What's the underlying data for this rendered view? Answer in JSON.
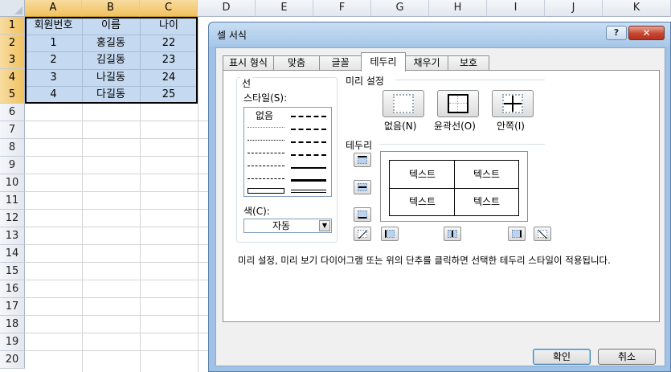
{
  "sheet": {
    "columns": [
      "A",
      "B",
      "C",
      "D",
      "E",
      "F",
      "G",
      "H",
      "I",
      "J",
      "K"
    ],
    "rows": [
      "1",
      "2",
      "3",
      "4",
      "5",
      "6",
      "7",
      "8",
      "9",
      "10",
      "11",
      "12",
      "13",
      "14",
      "15",
      "16",
      "17",
      "18",
      "19",
      "20"
    ],
    "header": [
      "회원번호",
      "이름",
      "나이"
    ],
    "data": [
      [
        "1",
        "홍길동",
        "22"
      ],
      [
        "2",
        "김길동",
        "23"
      ],
      [
        "3",
        "나길동",
        "24"
      ],
      [
        "4",
        "다길동",
        "25"
      ]
    ],
    "selection_color": "#c5d9f1"
  },
  "dialog": {
    "title": "셀 서식",
    "help_label": "?",
    "close_label": "✕",
    "tabs": [
      "표시 형식",
      "맞춤",
      "글꼴",
      "테두리",
      "채우기",
      "보호"
    ],
    "active_tab": "테두리",
    "line_group": {
      "title": "선",
      "style_label": "스타일(S):",
      "none_label": "없음",
      "color_label": "색(C):",
      "color_value": "자동"
    },
    "presets": {
      "title": "미리 설정",
      "none": "없음(N)",
      "outline": "윤곽선(O)",
      "inside": "안쪽(I)"
    },
    "border": {
      "title": "테두리",
      "preview_cells": [
        "텍스트",
        "텍스트",
        "텍스트",
        "텍스트"
      ]
    },
    "description": "미리 설정, 미리 보기 다이어그램 또는 위의 단추를 클릭하면 선택한 테두리 스타일이 적용됩니다.",
    "ok_label": "확인",
    "cancel_label": "취소"
  }
}
